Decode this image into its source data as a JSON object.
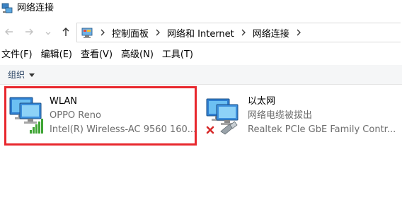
{
  "window": {
    "title": "网络连接",
    "title_icon": "network-connections-icon"
  },
  "nav": {
    "back_icon": "arrow-left-icon",
    "forward_icon": "arrow-right-icon",
    "recent_icon": "chevron-down-icon",
    "up_icon": "arrow-up-icon"
  },
  "address": {
    "icon": "control-panel-icon",
    "breadcrumbs": [
      "控制面板",
      "网络和 Internet",
      "网络连接"
    ]
  },
  "menu": {
    "items": [
      "文件(F)",
      "编辑(E)",
      "查看(V)",
      "高级(N)",
      "工具(T)"
    ]
  },
  "command_bar": {
    "organize_label": "组织"
  },
  "connections": [
    {
      "name": "WLAN",
      "status": "OPPO Reno",
      "device": "Intel(R) Wireless-AC 9560 160...",
      "icon": "wireless-adapter-icon",
      "highlighted": true
    },
    {
      "name": "以太网",
      "status": "网络电缆被拔出",
      "device": "Realtek PCIe GbE Family Contr...",
      "icon": "ethernet-adapter-disconnected-icon",
      "highlighted": false
    }
  ],
  "colors": {
    "highlight": "#e8272d",
    "secondary_text": "#6d6d6d",
    "command_bar_bg": "#f5f6f7"
  }
}
